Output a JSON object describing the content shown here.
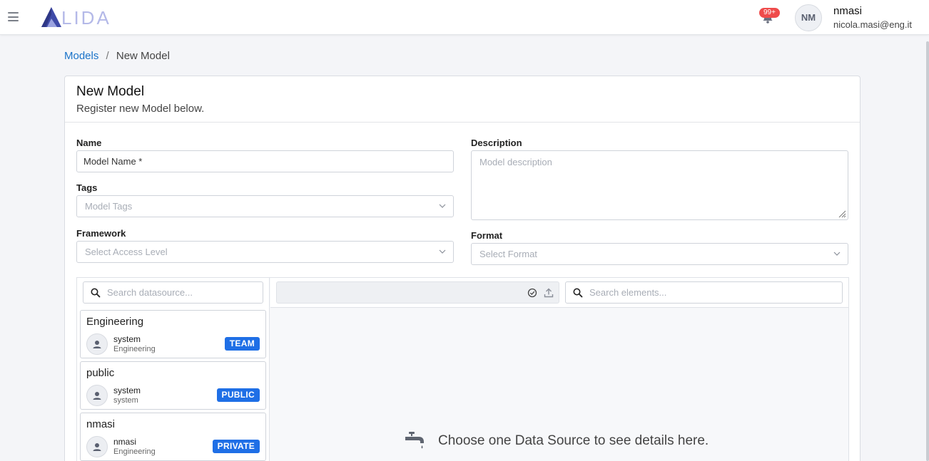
{
  "header": {
    "logo_text": "LIDA",
    "notifications_badge": "99+",
    "avatar_initials": "NM",
    "user_name": "nmasi",
    "user_email": "nicola.masi@eng.it"
  },
  "breadcrumb": {
    "parent": "Models",
    "separator": "/",
    "current": "New Model"
  },
  "card": {
    "title": "New Model",
    "subtitle": "Register new Model below."
  },
  "form": {
    "name_label": "Name",
    "name_value": "Model Name *",
    "tags_label": "Tags",
    "tags_placeholder": "Model Tags",
    "framework_label": "Framework",
    "framework_placeholder": "Select Access Level",
    "description_label": "Description",
    "description_placeholder": "Model description",
    "format_label": "Format",
    "format_placeholder": "Select Format"
  },
  "datasources": {
    "search_placeholder": "Search datasource...",
    "elements_search_placeholder": "Search elements...",
    "empty_message": "Choose one Data Source to see details here.",
    "items": [
      {
        "title": "Engineering",
        "owner": "system",
        "org": "Engineering",
        "tag": "TEAM"
      },
      {
        "title": "public",
        "owner": "system",
        "org": "system",
        "tag": "PUBLIC"
      },
      {
        "title": "nmasi",
        "owner": "nmasi",
        "org": "Engineering",
        "tag": "PRIVATE"
      }
    ]
  },
  "colors": {
    "accent": "#1f6fe6",
    "link": "#1a73c9",
    "badge": "#ef4b4b",
    "logo": "#b4b9e8"
  },
  "icons": [
    "menu-icon",
    "bell-icon",
    "search-icon",
    "chevron-down-icon",
    "user-icon",
    "check-circle-icon",
    "upload-icon",
    "faucet-icon",
    "resize-handle-icon"
  ]
}
